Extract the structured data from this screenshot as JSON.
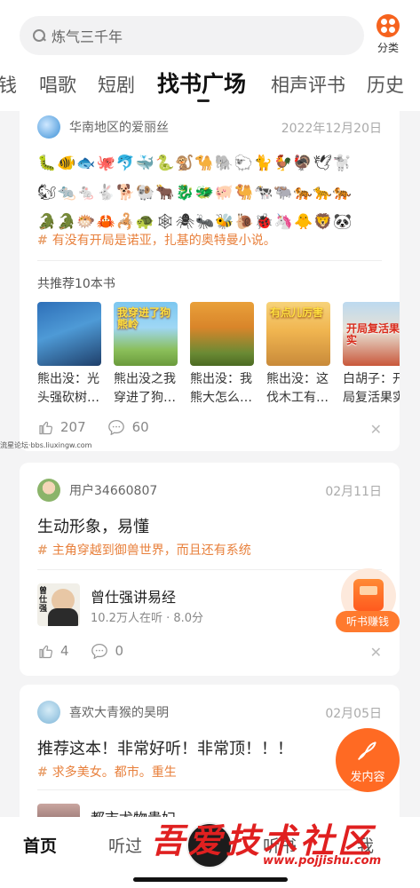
{
  "search": {
    "placeholder": "炼气三千年"
  },
  "category": {
    "label": "分类"
  },
  "tabs": [
    {
      "label": "钱"
    },
    {
      "label": "唱歌"
    },
    {
      "label": "短剧"
    },
    {
      "label": "找书广场",
      "active": true
    },
    {
      "label": "相声评书"
    },
    {
      "label": "历史"
    }
  ],
  "post1": {
    "user": "华南地区的爱丽丝",
    "date": "2022年12月20日",
    "emoji_lines": [
      "🐛🐠🐟🐙🐬🐳🐍🐒🐪🐘🐑🐈🐓🦃🕊🐩",
      "🐿🐀🐁🐇🐕🐏🐂🐉🐲🐖🐫🐄🐃🐅🐆🐅",
      "🐊🐊🐡🦀🦂🐢🕸🕷🐜🐝🐌🐞🦄🐥🦁🐼"
    ],
    "tag": "有没有开局是诺亚，扎基的奥特曼小说。",
    "rec_title": "共推荐10本书",
    "books": [
      {
        "title": "熊出没：光头强砍树…",
        "cover_text": ""
      },
      {
        "title": "熊出没之我穿进了狗…",
        "cover_text": "我穿进了狗熊岭"
      },
      {
        "title": "熊出没：我熊大怎么…",
        "cover_text": ""
      },
      {
        "title": "熊出没：这伐木工有…",
        "cover_text": "有点儿厉害"
      },
      {
        "title": "白胡子：开局复活果实",
        "cover_text": "开局复活果实"
      }
    ],
    "likes": "207",
    "comments": "60"
  },
  "watermark_small": "流星论坛·bbs.liuxingw.com",
  "post2": {
    "user": "用户34660807",
    "date": "02月11日",
    "text": "生动形象，易懂",
    "tag": "主角穿越到御兽世界，而且还有系统",
    "audio_title": "曾仕强讲易经",
    "audio_sub": "10.2万人在听 · 8.0分",
    "audio_cover_text": "曾仕强",
    "likes": "4",
    "comments": "0"
  },
  "post3": {
    "user": "喜欢大青猴的昊明",
    "date": "02月05日",
    "text": "推荐这本！非常好听！非常顶！！！",
    "tag": "求多美女。都市。重生",
    "next_title": "都市尤物贵妇"
  },
  "float_earn": {
    "label": "听书赚钱"
  },
  "float_post": {
    "label": "发内容"
  },
  "bottom_nav": [
    {
      "label": "首页",
      "active": true
    },
    {
      "label": "听过"
    },
    {
      "label": "听书"
    },
    {
      "label": "我"
    }
  ],
  "watermark": {
    "text": "吾爱技术社区",
    "url": "www.pojjishu.com"
  },
  "colors": {
    "accent": "#ff6a23",
    "tag": "#e8803c"
  }
}
